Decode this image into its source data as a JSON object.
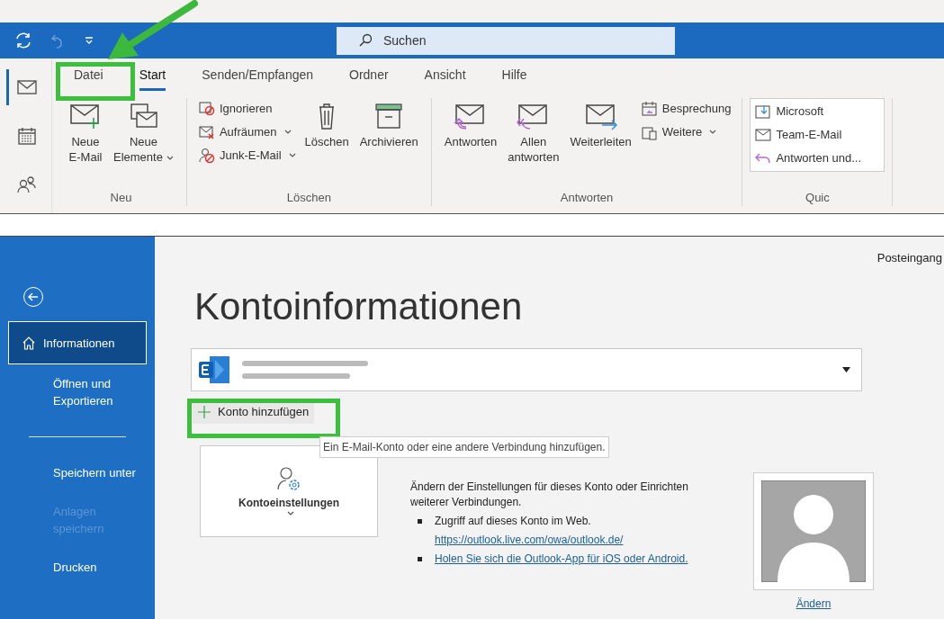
{
  "title_bar": {
    "search_placeholder": "Suchen"
  },
  "app_nav": [
    {
      "kind": "mail",
      "selected": true
    },
    {
      "kind": "calendar",
      "selected": false
    },
    {
      "kind": "people",
      "selected": false
    }
  ],
  "ribbon_tabs": [
    {
      "label": "Datei",
      "selected": false
    },
    {
      "label": "Start",
      "selected": true
    },
    {
      "label": "Senden/Empfangen",
      "selected": false
    },
    {
      "label": "Ordner",
      "selected": false
    },
    {
      "label": "Ansicht",
      "selected": false
    },
    {
      "label": "Hilfe",
      "selected": false
    }
  ],
  "ribbon_groups": [
    {
      "kind": "large_only",
      "label": "Neu",
      "large": [
        {
          "label": "Neue\nE-Mail",
          "menu": false
        },
        {
          "label": "Neue\nElemente",
          "menu": true
        }
      ]
    },
    {
      "kind": "small_then_large",
      "label": "Löschen",
      "small": [
        {
          "label": "Ignorieren",
          "menu": false
        },
        {
          "label": "Aufräumen",
          "menu": true
        },
        {
          "label": "Junk-E-Mail",
          "menu": true
        }
      ],
      "large": [
        {
          "label": "Löschen",
          "menu": false
        },
        {
          "label": "Archivieren",
          "menu": false
        }
      ]
    },
    {
      "kind": "large_then_small",
      "label": "Antworten",
      "large": [
        {
          "label": "Antworten",
          "menu": false
        },
        {
          "label": "Allen\nantworten",
          "menu": false
        },
        {
          "label": "Weiterleiten",
          "menu": false
        }
      ],
      "small": [
        {
          "label": "Besprechung",
          "menu": false
        },
        {
          "label": "Weitere",
          "menu": true
        }
      ]
    },
    {
      "kind": "quick",
      "label": "Quic",
      "small": [
        {
          "label": "Microsoft",
          "menu": false
        },
        {
          "label": "Team-E-Mail",
          "menu": false
        },
        {
          "label": "Antworten und...",
          "menu": false
        }
      ]
    }
  ],
  "backstage": {
    "nav": [
      {
        "kind": "item",
        "label": "Informationen",
        "selected": true,
        "disabled": false
      },
      {
        "kind": "item",
        "label": "Öffnen und\nExportieren",
        "selected": false,
        "disabled": false
      },
      {
        "kind": "separator"
      },
      {
        "kind": "item",
        "label": "Speichern unter",
        "selected": false,
        "disabled": false
      },
      {
        "kind": "item",
        "label": "Anlagen\nspeichern",
        "selected": false,
        "disabled": true
      },
      {
        "kind": "item",
        "label": "Drucken",
        "selected": false,
        "disabled": false
      }
    ],
    "location": "Posteingang",
    "title": "Kontoinformationen",
    "add_account": "Konto hinzufügen",
    "tooltip": "Ein E-Mail-Konto oder eine andere Verbindung hinzufügen.",
    "settings_tile": "Kontoeinstellungen",
    "description": "Ändern der Einstellungen für dieses Konto oder Einrichten weiterer Verbindungen.",
    "bullets": [
      {
        "text": "Zugriff auf dieses Konto im Web.",
        "link": "https://outlook.live.com/owa/outlook.de/"
      },
      {
        "link": "Holen Sie sich die Outlook-App für iOS oder Android."
      }
    ],
    "change_photo": "Ändern"
  }
}
